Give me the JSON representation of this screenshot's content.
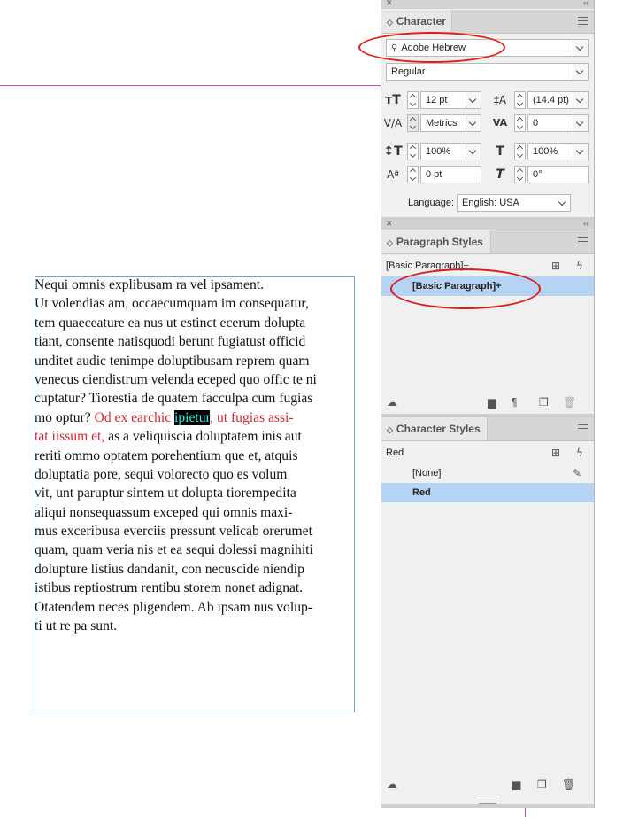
{
  "story": {
    "lines": [
      "Nequi omnis explibusam ra vel ipsament.",
      "Ut volendias am, occaecumquam im consequatur,",
      "tem quaeceature ea nus ut estinct ecerum dolupta",
      "tiant, consente natisquodi berunt fugiatust officid",
      "unditet audic tenimpe doluptibusam reprem quam",
      "venecus ciendistrum velenda eceped quo offic te ni",
      "cuptatur? Tiorestia de quatem facculpa cum fugias"
    ],
    "line8_plain": "mo optur? ",
    "line8_red": "Od ex earchic ",
    "line8_selected": "ipietur",
    "line8_red_after": ", ut fugias assi-",
    "line9_red": "tat iissum et,",
    "line9_plain": " as a veliquiscia doluptatem inis aut",
    "lines_after": [
      "reriti ommo optatem porehentium que et, atquis",
      "doluptatia pore, sequi volorecto quo es volum",
      "vit, unt paruptur sintem ut dolupta tiorempedita",
      "aliqui nonsequassum exceped qui omnis maxi-",
      "mus exceribusa everciis pressunt velicab orerumet",
      "quam, quam veria nis et ea sequi dolessi magnihiti",
      "dolupture listius dandanit, con necuscide niendip",
      "istibus reptiostrum rentibu storem nonet adignat.",
      "Otatendem neces pligendem. Ab ipsam nus volup-",
      "ti ut re pa sunt."
    ]
  },
  "character_panel": {
    "title": "Character",
    "font_family": "Adobe Hebrew",
    "font_style": "Regular",
    "font_size": "12 pt",
    "leading": "(14.4 pt)",
    "kerning": "Metrics",
    "tracking": "0",
    "vertical_scale": "100%",
    "horizontal_scale": "100%",
    "baseline_shift": "0 pt",
    "skew": "0°",
    "language_label": "Language:",
    "language": "English: USA"
  },
  "paragraph_styles": {
    "title": "Paragraph Styles",
    "current": "[Basic Paragraph]+",
    "items": [
      "[Basic Paragraph]+"
    ]
  },
  "character_styles": {
    "title": "Character Styles",
    "current": "Red",
    "items": [
      "[None]",
      "Red"
    ]
  },
  "colors": {
    "selection_highlight": "#b5d3f3",
    "annotation_circle": "#e01919",
    "red_text": "#d22730",
    "selected_text": "#2ff0e8"
  }
}
